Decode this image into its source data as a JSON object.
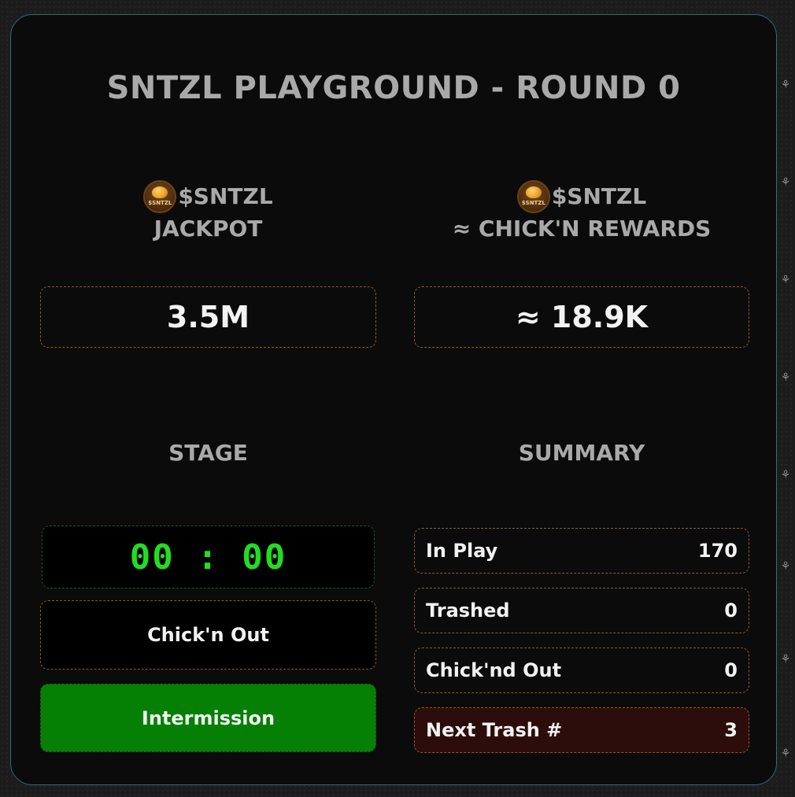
{
  "title": "SNTZL PLAYGROUND - ROUND 0",
  "jackpot": {
    "coin_label": "$SNTZL",
    "token": "$SNTZL",
    "label": "JACKPOT",
    "value": "3.5M"
  },
  "rewards": {
    "coin_label": "$SNTZL",
    "token": "$SNTZL",
    "label": "≈ CHICK'N REWARDS",
    "value": "≈ 18.9K"
  },
  "stage": {
    "heading": "STAGE",
    "timer": "00 : 00",
    "chickout_button": "Chick'n Out",
    "intermission_button": "Intermission"
  },
  "summary": {
    "heading": "SUMMARY",
    "rows": [
      {
        "label": "In Play",
        "value": "170"
      },
      {
        "label": "Trashed",
        "value": "0"
      },
      {
        "label": "Chick'nd Out",
        "value": "0"
      },
      {
        "label": "Next Trash #",
        "value": "3"
      }
    ]
  },
  "colors": {
    "panel_border": "#2a6e78",
    "timer_digits": "#22dd22",
    "intermission_bg": "#058005",
    "next_trash_bg": "#2c0d0b",
    "box_border": "#8a5a2a"
  }
}
